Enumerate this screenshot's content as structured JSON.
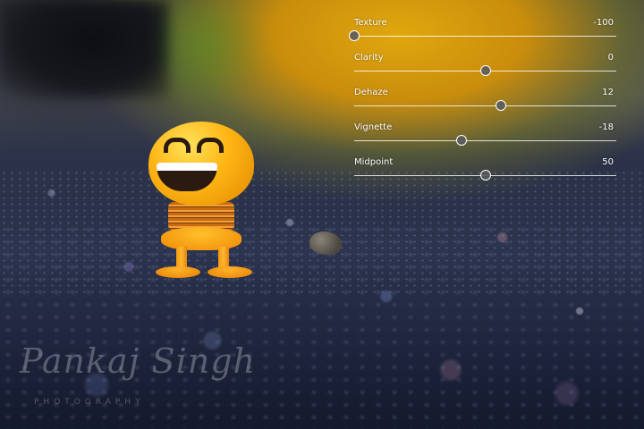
{
  "sliders": [
    {
      "label": "Texture",
      "value": "-100",
      "position": 0.0
    },
    {
      "label": "Clarity",
      "value": "0",
      "position": 0.5
    },
    {
      "label": "Dehaze",
      "value": "12",
      "position": 0.56
    },
    {
      "label": "Vignette",
      "value": "-18",
      "position": 0.41
    },
    {
      "label": "Midpoint",
      "value": "50",
      "position": 0.5
    }
  ],
  "watermark": {
    "name": "Pankaj Singh",
    "subtitle": "PHOTOGRAPHY"
  }
}
